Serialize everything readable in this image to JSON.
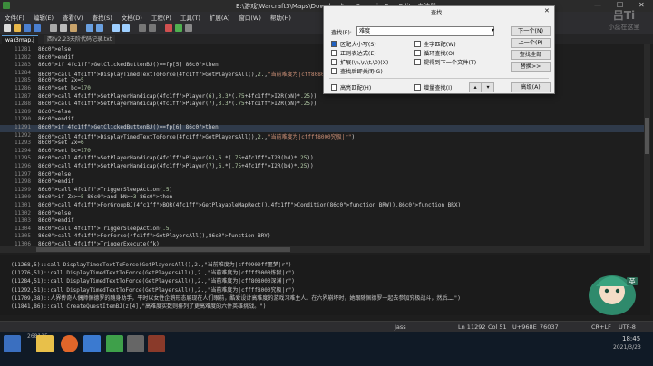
{
  "window": {
    "title": "E:\\游戏\\Warcraft3\\Maps\\Download\\war3map.j - EverEdit - 未注册"
  },
  "menu": [
    "文件(F)",
    "编辑(E)",
    "查看(V)",
    "查找(S)",
    "文档(D)",
    "工程(P)",
    "工具(T)",
    "扩展(A)",
    "窗口(W)",
    "帮助(H)"
  ],
  "tabs": [
    {
      "label": "war3map.j"
    },
    {
      "label": "西fv2.23天阶代码记录.txt"
    }
  ],
  "editor": {
    "lines": [
      {
        "n": "11281",
        "t": "else"
      },
      {
        "n": "11282",
        "t": "endif"
      },
      {
        "n": "11283",
        "t": "if GetClickedButtonBJ()==fp[5] then"
      },
      {
        "n": "11284",
        "t": "call DisplayTimedTextToForce(GetPlayersAll(),2.,\"当前难度为|cff808000深渊|r\")"
      },
      {
        "n": "11285",
        "t": "set Zx=5"
      },
      {
        "n": "11286",
        "t": "set bc=170"
      },
      {
        "n": "11287",
        "t": "call SetPlayerHandicap(Player(6),3.3*(.75+I2R(bN)*.25))"
      },
      {
        "n": "11288",
        "t": "call SetPlayerHandicap(Player(7),3.3*(.75+I2R(bN)*.25))"
      },
      {
        "n": "11289",
        "t": "else"
      },
      {
        "n": "11290",
        "t": "endif"
      },
      {
        "n": "11291",
        "t": "if GetClickedButtonBJ()==fp[6] then"
      },
      {
        "n": "11292",
        "t": "call DisplayTimedTextToForce(GetPlayersAll(),2.,\"当前难度为|cffff8000究极|r\")"
      },
      {
        "n": "11293",
        "t": "set Zx=6"
      },
      {
        "n": "11294",
        "t": "set bc=170"
      },
      {
        "n": "11295",
        "t": "call SetPlayerHandicap(Player(6),6.*(.75+I2R(bN)*.25))"
      },
      {
        "n": "11296",
        "t": "call SetPlayerHandicap(Player(7),6.*(.75+I2R(bN)*.25))"
      },
      {
        "n": "11297",
        "t": "else"
      },
      {
        "n": "11298",
        "t": "endif"
      },
      {
        "n": "11299",
        "t": "call TriggerSleepAction(.5)"
      },
      {
        "n": "11300",
        "t": "if Zx>=5 and bN>=3 then"
      },
      {
        "n": "11301",
        "t": "call ForGroupBJ(BOR(GetPlayableMapRect(),Condition(function BRW)),function BRX)"
      },
      {
        "n": "11302",
        "t": "else"
      },
      {
        "n": "11303",
        "t": "endif"
      },
      {
        "n": "11304",
        "t": "call TriggerSleepAction(.5)"
      },
      {
        "n": "11305",
        "t": "call ForForce(GetPlayersAll(),function BRY)"
      },
      {
        "n": "11306",
        "t": "call TriggerExecute(fk)"
      }
    ]
  },
  "output": {
    "lines": [
      "(11268,5)::call DisplayTimedTextToForce(GetPlayersAll(),2.,\"当前难度为|cff9900ff噩梦|r\")",
      "(11276,51)::call DisplayTimedTextToForce(GetPlayersAll(),2.,\"当前难度为|cffff0000炼狱|r\")",
      "(11284,51)::call DisplayTimedTextToForce(GetPlayersAll(),2.,\"当前难度为|cff808000深渊|r\")",
      "(11292,51)::call DisplayTimedTextToForce(GetPlayersAll(),2.,\"当前难度为|cffff8000究极|r\")",
      "(11709,38)::人界传奇人偶师佩德罗的随身助手，平时以女性企鹅形态展现在人们眼前，酷爱设计高难度的游戏习难主人。在六界崩坏时，她跟随佩德罗一起去参加究极战斗，然后……\")",
      "(11841,86)::call CreateQuestItemBJ(z[4],\"高难度实数则排列了更高难度的六件英雄挑战。\")"
    ]
  },
  "status": {
    "lang": "Jass",
    "pos": "Ln 11292",
    "col": "Col 51",
    "char": "U+968E",
    "offset": "76037",
    "eol": "CR+LF",
    "enc": "UTF-8"
  },
  "taskbar": {
    "time": "18:45",
    "date": "2021/3/23",
    "counter": "268115"
  },
  "find": {
    "title": "查找",
    "find_label": "查找(F):",
    "find_value": "难度",
    "next": "下一个(N)",
    "prev": "上一个(P)",
    "find_all": "查找全部",
    "replace": "替换>>",
    "advanced": "高级(A)",
    "options": [
      {
        "label": "区配大小写(S)",
        "on": true
      },
      {
        "label": "全字匹配(W)",
        "on": false
      },
      {
        "label": "正则表达式(E)",
        "on": false
      },
      {
        "label": "循环查找(O)",
        "on": false
      },
      {
        "label": "扩展(\\n,\\r,\\t,\\0)(X)",
        "on": false
      },
      {
        "label": "提得到下一个文件(T)",
        "on": false
      },
      {
        "label": "查找后即关闭(G)",
        "on": false
      }
    ],
    "bottom": [
      {
        "label": "高亮匹配(H)",
        "on": false
      },
      {
        "label": "增量查找(I)",
        "on": false
      }
    ]
  },
  "watermark": {
    "line1": "吕Ti",
    "line2": "小蕊在这里"
  },
  "colors": {
    "keyword": "#c586c0",
    "func": "#4fc1ff",
    "string": "#ce9178",
    "number": "#b5cea8",
    "text": "#d4d4d4",
    "output": "#c8c8c8"
  }
}
